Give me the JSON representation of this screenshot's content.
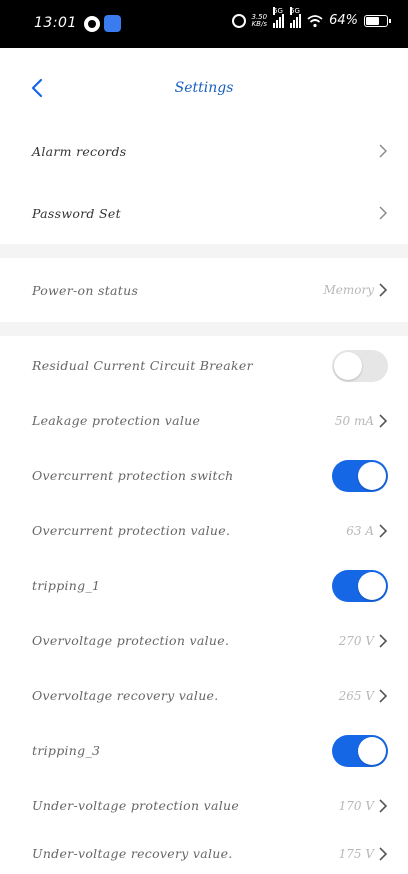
{
  "status_bar": {
    "time": "13:01",
    "net_speed_value": "3.50",
    "net_speed_unit": "KB/s",
    "signal1_label": "5G",
    "signal2_label": "5G",
    "battery_percent": "64%"
  },
  "header": {
    "title": "Settings"
  },
  "section1": {
    "alarm_records": "Alarm records",
    "password_set": "Password Set"
  },
  "section2": {
    "power_on_label": "Power-on status",
    "power_on_value": "Memory"
  },
  "section3": {
    "rccb_label": "Residual Current Circuit Breaker",
    "rccb_on": false,
    "leakage_label": "Leakage protection value",
    "leakage_value": "50 mA",
    "overcurrent_switch_label": "Overcurrent protection switch",
    "overcurrent_switch_on": true,
    "overcurrent_value_label": "Overcurrent protection value.",
    "overcurrent_value": "63 A",
    "tripping1_label": "tripping_1",
    "tripping1_on": true,
    "overvoltage_prot_label": "Overvoltage protection value.",
    "overvoltage_prot_value": "270 V",
    "overvoltage_rec_label": "Overvoltage recovery value.",
    "overvoltage_rec_value": "265 V",
    "tripping3_label": "tripping_3",
    "tripping3_on": true,
    "undervoltage_prot_label": "Under-voltage protection value",
    "undervoltage_prot_value": "170 V",
    "undervoltage_rec_label": "Under-voltage recovery value.",
    "undervoltage_rec_value": "175 V"
  },
  "colors": {
    "accent": "#1667e6",
    "title": "#1a5fbf",
    "separator": "#f4f4f4"
  }
}
